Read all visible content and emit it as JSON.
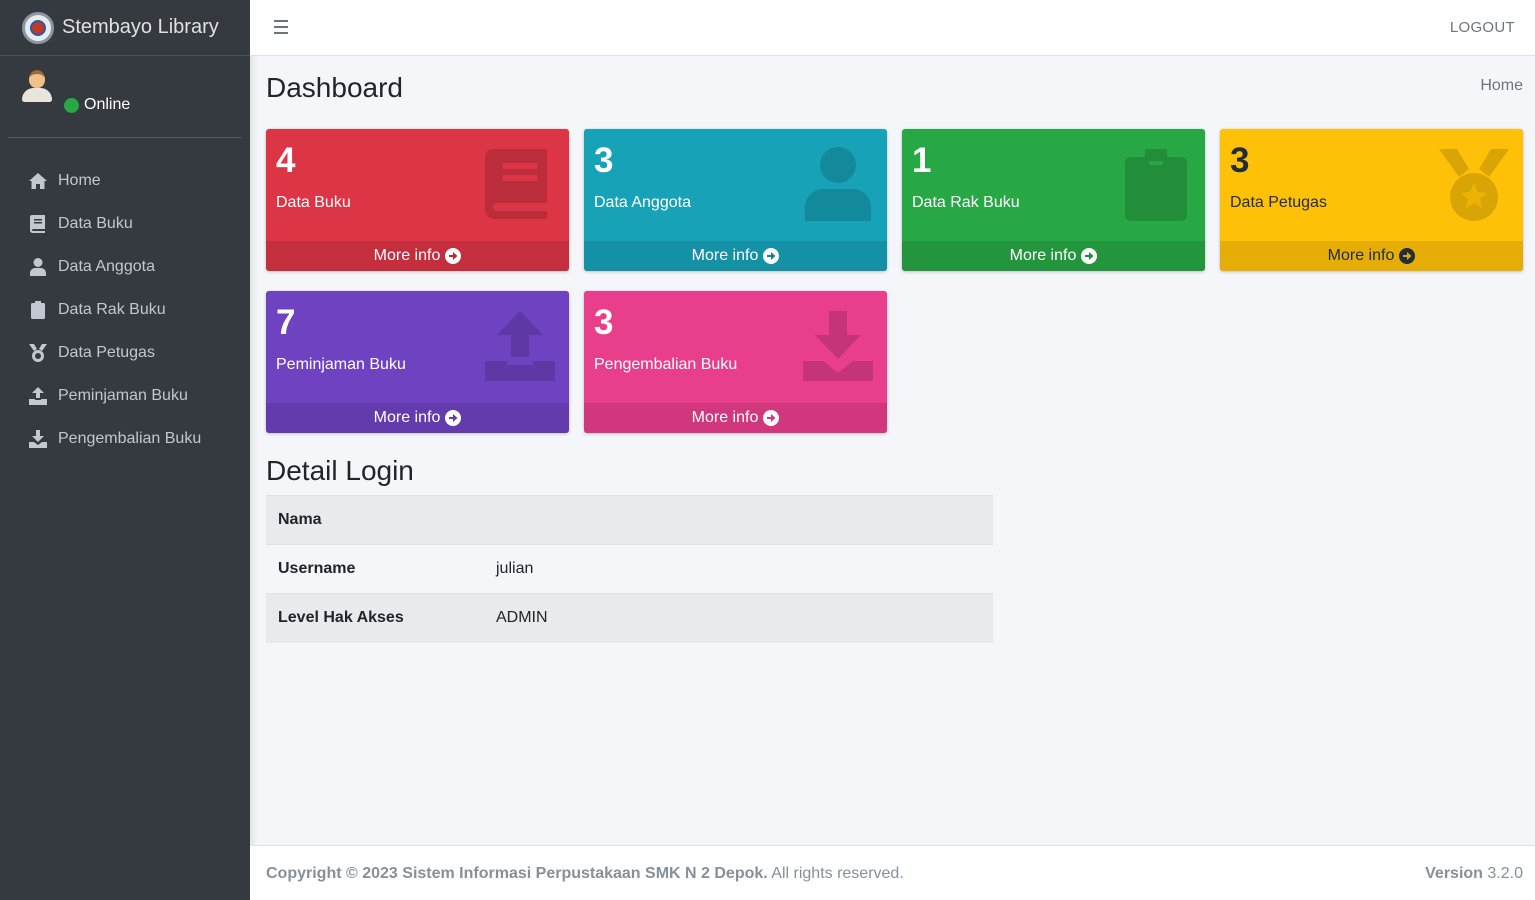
{
  "brand": {
    "name": "Stembayo Library"
  },
  "user": {
    "status": "Online"
  },
  "sidebar": {
    "items": [
      {
        "label": "Home",
        "icon": "home-icon"
      },
      {
        "label": "Data Buku",
        "icon": "book-icon"
      },
      {
        "label": "Data Anggota",
        "icon": "user-icon"
      },
      {
        "label": "Data Rak Buku",
        "icon": "clipboard-icon"
      },
      {
        "label": "Data Petugas",
        "icon": "medal-icon"
      },
      {
        "label": "Peminjaman Buku",
        "icon": "upload-icon"
      },
      {
        "label": "Pengembalian Buku",
        "icon": "download-icon"
      }
    ]
  },
  "header": {
    "logout": "LOGOUT"
  },
  "page": {
    "title": "Dashboard",
    "breadcrumb": "Home"
  },
  "boxes": [
    {
      "count": "4",
      "label": "Data Buku",
      "more": "More info",
      "color": "#dc3545",
      "icon": "book-icon"
    },
    {
      "count": "3",
      "label": "Data Anggota",
      "more": "More info",
      "color": "#17a2b8",
      "icon": "user-icon"
    },
    {
      "count": "1",
      "label": "Data Rak Buku",
      "more": "More info",
      "color": "#28a745",
      "icon": "clipboard-icon"
    },
    {
      "count": "3",
      "label": "Data Petugas",
      "more": "More info",
      "color": "#ffc107",
      "icon": "medal-icon"
    },
    {
      "count": "7",
      "label": "Peminjaman Buku",
      "more": "More info",
      "color": "#6f42c1",
      "icon": "upload-icon"
    },
    {
      "count": "3",
      "label": "Pengembalian Buku",
      "more": "More info",
      "color": "#e83e8c",
      "icon": "download-icon"
    }
  ],
  "detail": {
    "title": "Detail Login",
    "rows": [
      {
        "key": "Nama",
        "value": ""
      },
      {
        "key": "Username",
        "value": "julian"
      },
      {
        "key": "Level Hak Akses",
        "value": "ADMIN"
      }
    ]
  },
  "footer": {
    "copyright": "Copyright © 2023 Sistem Informasi Perpustakaan SMK N 2 Depok.",
    "rights": "All rights reserved.",
    "version_label": "Version",
    "version": "3.2.0"
  }
}
